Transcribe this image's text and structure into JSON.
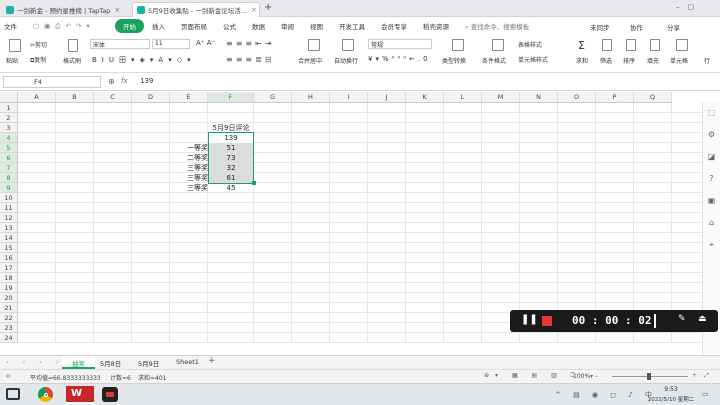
{
  "tabs": [
    {
      "label": "一剑新金 - 预约星推榜 | TapTap"
    },
    {
      "label": "5月9日收集贴 - 一剑新金论坛活..."
    }
  ],
  "menu": [
    "文件",
    "开始",
    "插入",
    "页面布局",
    "公式",
    "数据",
    "审阅",
    "视图",
    "开发工具",
    "会员专享",
    "稻壳资源"
  ],
  "search_placeholder": "查找命令、搜索模板",
  "top_right": {
    "sync": "未同步",
    "collab": "协作",
    "share": "分享"
  },
  "ribbon": {
    "paste": "粘贴",
    "cut": "剪切",
    "copy": "复制",
    "format_painter": "格式刷",
    "font": "宋体",
    "size": "11",
    "merge": "合并居中",
    "wrap": "自动换行",
    "numfmt": "常规",
    "type_convert": "类型转换",
    "cond_fmt": "条件格式",
    "table_style": "表格样式",
    "cell_style": "单元格样式",
    "sum": "求和",
    "filter": "筛选",
    "sort": "排序",
    "fill": "填充",
    "cell": "单元格",
    "row": "行"
  },
  "formula_bar": {
    "cell_ref": "F4",
    "fx": "fx",
    "value": "139"
  },
  "columns": [
    "A",
    "B",
    "C",
    "D",
    "E",
    "F",
    "G",
    "H",
    "I",
    "J",
    "K",
    "L",
    "M",
    "N",
    "O",
    "P",
    "Q"
  ],
  "rows": [
    "1",
    "2",
    "3",
    "4",
    "5",
    "6",
    "7",
    "8",
    "9",
    "10",
    "11",
    "12",
    "13",
    "14",
    "15",
    "16",
    "17",
    "18",
    "19",
    "20",
    "21",
    "22",
    "23",
    "24"
  ],
  "cells": {
    "f3": "5月9日评论",
    "f4": "139",
    "e5": "一等奖",
    "f5": "51",
    "e6": "二等奖",
    "f6": "73",
    "e7": "三等奖",
    "f7": "32",
    "e8": "三等奖",
    "f8": "61",
    "e9": "三等奖",
    "f9": "45"
  },
  "sheets": [
    "抽奖",
    "5月8日",
    "5月9日",
    "Sheet1"
  ],
  "status": {
    "avg": "平均值=66.8333333333",
    "count": "计数=6",
    "sum": "求和=401",
    "zoom": "100%"
  },
  "clock": {
    "time": "9:53",
    "date": "2022/5/10 星期二"
  },
  "recorder": {
    "timer": "00 : 00 : 02"
  }
}
